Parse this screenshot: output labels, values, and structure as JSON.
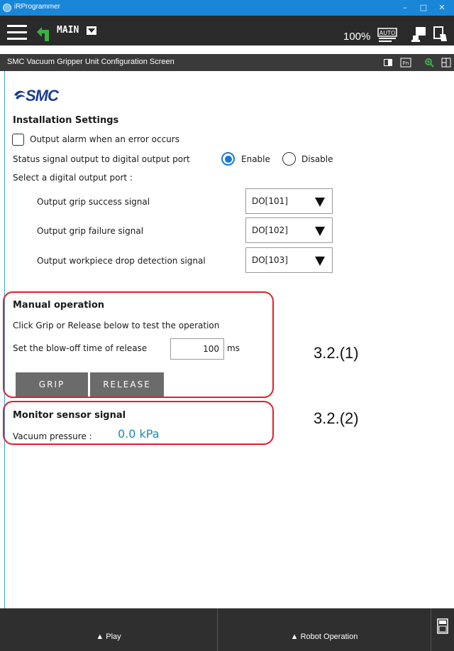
{
  "window": {
    "title": "iRProgrammer",
    "minimize": "–",
    "maximize": "□",
    "close": "✕"
  },
  "toolbar": {
    "program_name": "MAIN",
    "override": "100%"
  },
  "screen": {
    "title": "SMC Vacuum Gripper Unit Configuration Screen"
  },
  "logo": {
    "text": "SMC"
  },
  "installation": {
    "heading": "Installation Settings",
    "alarm_label": "Output alarm when an error occurs",
    "alarm_checked": false,
    "status_label": "Status signal output to digital output port",
    "enable_label": "Enable",
    "disable_label": "Disable",
    "status_selected": "Enable",
    "select_port_label": "Select a digital output port :",
    "ports": [
      {
        "label": "Output grip success signal",
        "value": "DO[101]"
      },
      {
        "label": "Output grip failure signal",
        "value": "DO[102]"
      },
      {
        "label": "Output workpiece drop detection signal",
        "value": "DO[103]"
      }
    ]
  },
  "manual": {
    "heading": "Manual operation",
    "instruction": "Click Grip or Release below to test the operation",
    "blowoff_label": "Set the blow-off time of release",
    "blowoff_value": "100",
    "blowoff_unit": "ms",
    "grip_label": "GRIP",
    "release_label": "RELEASE"
  },
  "monitor": {
    "heading": "Monitor sensor signal",
    "pressure_label": "Vacuum pressure :",
    "pressure_value": "0.0 kPa"
  },
  "annotations": {
    "manual": "3.2.(1)",
    "monitor": "3.2.(2)"
  },
  "bottombar": {
    "play_label": "▲ Play",
    "robot_label": "▲ Robot Operation"
  },
  "colors": {
    "titlebar": "#1a86d8",
    "toolbar": "#2a2a2a",
    "accent": "#1a78d8",
    "highlight": "#e0202a",
    "pressure": "#1a8ab8",
    "button": "#6b6b6b"
  }
}
